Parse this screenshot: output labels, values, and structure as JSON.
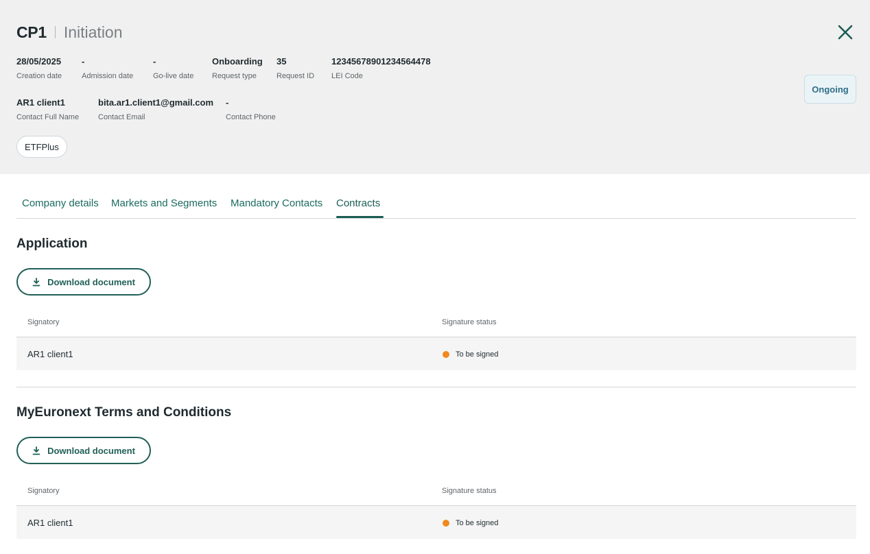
{
  "header": {
    "code": "CP1",
    "stage": "Initiation",
    "close_icon": "close-icon",
    "meta_row1": [
      {
        "value": "28/05/2025",
        "label": "Creation date"
      },
      {
        "value": "-",
        "label": "Admission date"
      },
      {
        "value": "-",
        "label": "Go-live date"
      },
      {
        "value": "Onboarding",
        "label": "Request type"
      },
      {
        "value": "35",
        "label": "Request ID"
      },
      {
        "value": "12345678901234564478",
        "label": "LEI Code"
      }
    ],
    "meta_row2": [
      {
        "value": "AR1 client1",
        "label": "Contact Full Name"
      },
      {
        "value": "bita.ar1.client1@gmail.com",
        "label": "Contact Email"
      },
      {
        "value": "-",
        "label": "Contact Phone"
      }
    ],
    "status": "Ongoing",
    "tag": "ETFPlus"
  },
  "tabs": [
    {
      "label": "Company details",
      "active": false
    },
    {
      "label": "Markets and Segments",
      "active": false
    },
    {
      "label": "Mandatory Contacts",
      "active": false
    },
    {
      "label": "Contracts",
      "active": true
    }
  ],
  "sections": [
    {
      "title": "Application",
      "download_label": "Download document",
      "download_icon": "download-icon",
      "columns": [
        "Signatory",
        "Signature status"
      ],
      "rows": [
        {
          "signatory": "AR1 client1",
          "status": "To be signed",
          "status_color": "#f08a1d"
        }
      ]
    },
    {
      "title": "MyEuronext Terms and Conditions",
      "download_label": "Download document",
      "download_icon": "download-icon",
      "columns": [
        "Signatory",
        "Signature status"
      ],
      "rows": [
        {
          "signatory": "AR1 client1",
          "status": "To be signed",
          "status_color": "#f08a1d"
        }
      ]
    }
  ],
  "colors": {
    "accent": "#1a5e53",
    "status_pill_text": "#2f6e86",
    "status_pill_bg": "#eaf4f7",
    "pending_dot": "#f08a1d",
    "header_bg": "#f0f0f0"
  }
}
